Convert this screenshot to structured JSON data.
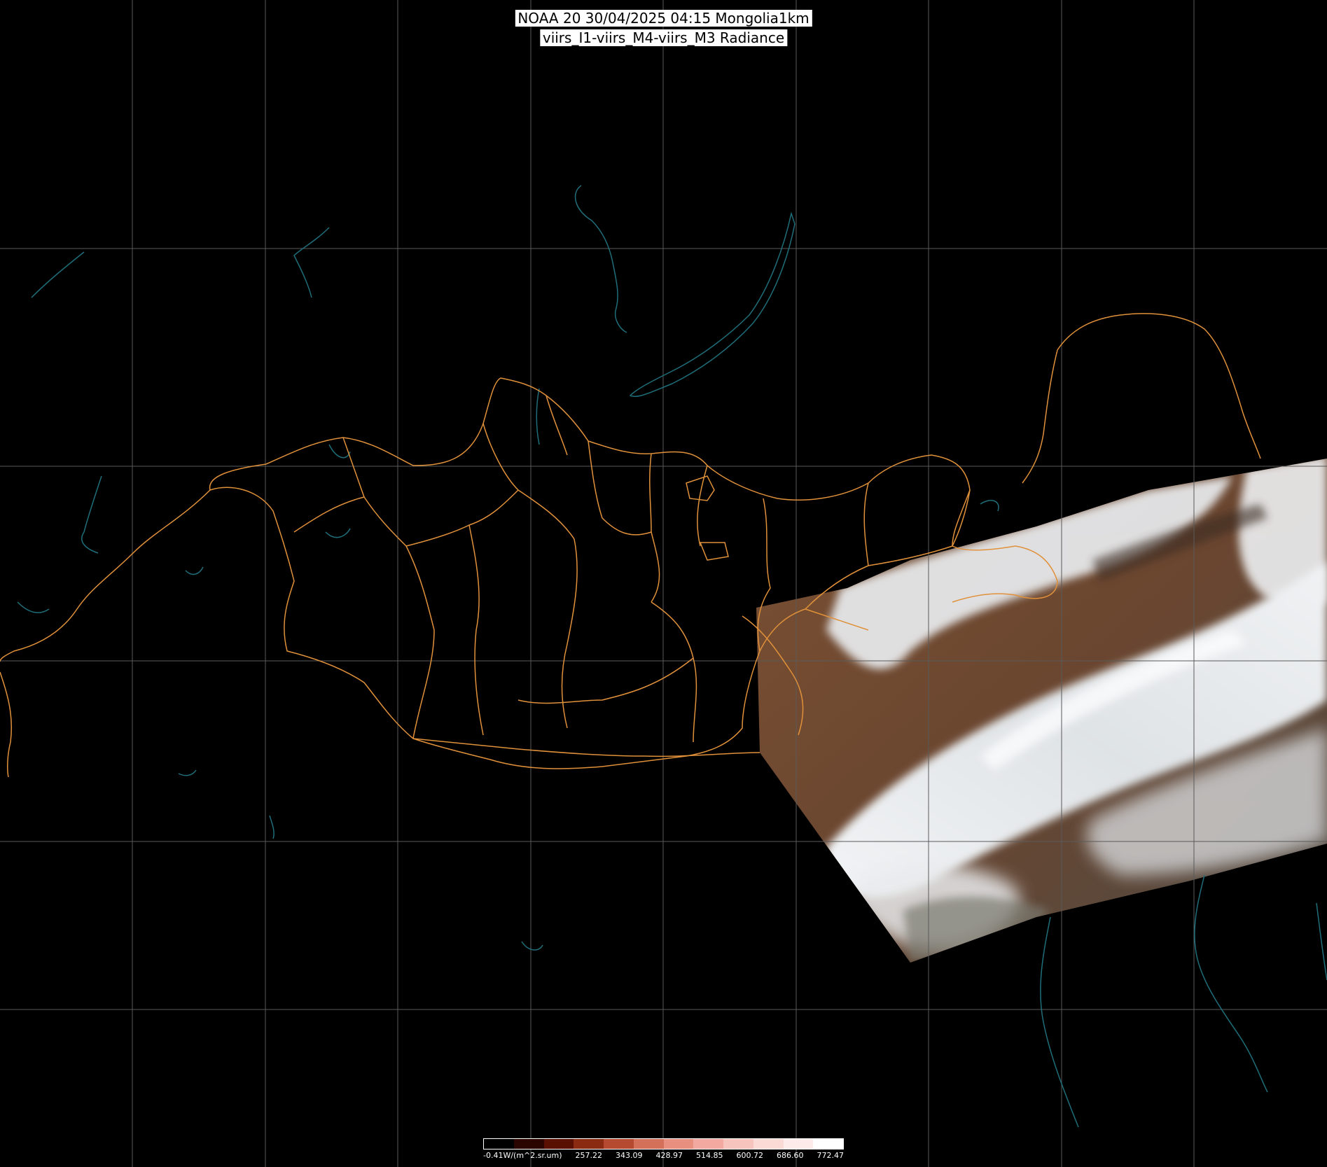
{
  "title": {
    "line1": "NOAA 20 30/04/2025 04:15 Mongolia1km",
    "line2": "viirs_I1-viirs_M4-viirs_M3 Radiance"
  },
  "colors": {
    "background": "#000000",
    "graticule": "#5a5a5a",
    "admin_boundaries": "#e0913a",
    "coastlines_lakes": "#1f6e7a",
    "cloud": "#e8ecf0",
    "land_brown": "#6e4a2f"
  },
  "colorbar": {
    "unit_label": "-0.41W/(m^2.sr.um)",
    "ticks": [
      "257.22",
      "343.09",
      "428.97",
      "514.85",
      "600.72",
      "686.60",
      "772.47"
    ],
    "colors": [
      "#000000",
      "#2a0500",
      "#5a1000",
      "#8a2a10",
      "#b54a30",
      "#d4705a",
      "#e88f80",
      "#f2aaa0",
      "#f7c4bd",
      "#fbdad6",
      "#fdebe9",
      "#ffffff"
    ]
  }
}
